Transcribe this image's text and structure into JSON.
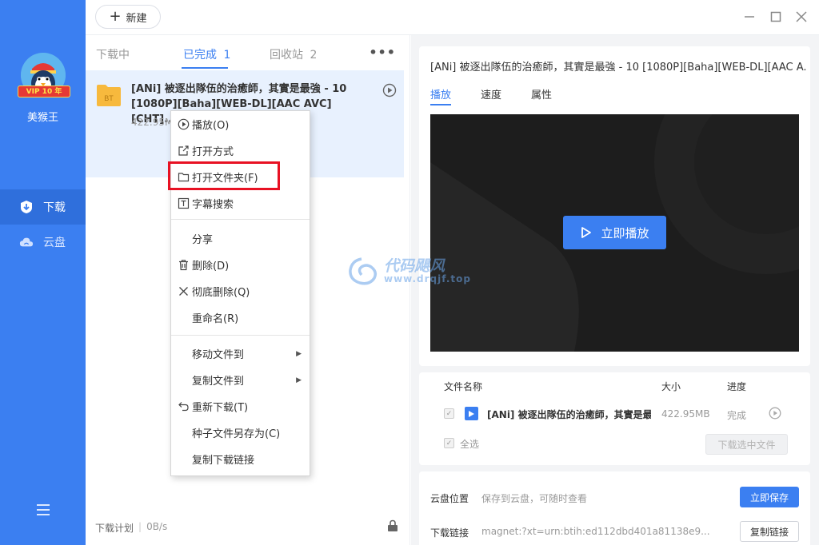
{
  "sidebar": {
    "vip_badge": "VIP 10 年",
    "username": "美猴王",
    "nav": [
      {
        "label": "下载"
      },
      {
        "label": "云盘"
      }
    ]
  },
  "topbar": {
    "new_label": "新建"
  },
  "list": {
    "tabs": [
      {
        "label": "下载中",
        "count": ""
      },
      {
        "label": "已完成",
        "count": "1"
      },
      {
        "label": "回收站",
        "count": "2"
      }
    ],
    "task": {
      "title": "[ANi] 被逐出隊伍的治癒師，其實是最強 - 10 [1080P][Baha][WEB-DL][AAC AVC][CHT]...",
      "size": "422.95M"
    },
    "footer": {
      "plan": "下载计划",
      "speed": "0B/s"
    }
  },
  "context_menu": {
    "items": [
      {
        "label": "播放(O)",
        "icon": "play-circle-icon"
      },
      {
        "label": "打开方式",
        "icon": "open-with-icon"
      },
      {
        "label": "打开文件夹(F)",
        "icon": "folder-icon"
      },
      {
        "label": "字幕搜索",
        "icon": "subtitle-icon"
      },
      {
        "label": "分享",
        "icon": ""
      },
      {
        "label": "删除(D)",
        "icon": "trash-icon"
      },
      {
        "label": "彻底删除(Q)",
        "icon": "close-icon"
      },
      {
        "label": "重命名(R)",
        "icon": ""
      },
      {
        "label": "移动文件到",
        "icon": ""
      },
      {
        "label": "复制文件到",
        "icon": ""
      },
      {
        "label": "重新下载(T)",
        "icon": "redo-icon"
      },
      {
        "label": "种子文件另存为(C)",
        "icon": ""
      },
      {
        "label": "复制下载链接",
        "icon": ""
      }
    ]
  },
  "detail": {
    "title": "[ANi] 被逐出隊伍的治癒師，其實是最強 - 10 [1080P][Baha][WEB-DL][AAC A...",
    "tabs": [
      {
        "label": "播放"
      },
      {
        "label": "速度"
      },
      {
        "label": "属性"
      }
    ],
    "play_now": "立即播放",
    "files": {
      "headers": {
        "name": "文件名称",
        "size": "大小",
        "progress": "进度"
      },
      "row": {
        "name": "[ANi] 被逐出隊伍的治癒師，其實是最強 - 10 [1080P][Baha][WEB-DL][AAC AVC][CHT].mp4",
        "size": "422.95MB",
        "status": "完成"
      },
      "select_all": "全选",
      "download_selected": "下载选中文件"
    },
    "cloud": {
      "label": "云盘位置",
      "text": "保存到云盘，可随时查看",
      "button": "立即保存"
    },
    "link": {
      "label": "下载链接",
      "text": "magnet:?xt=urn:btih:ed112dbd401a81138e9...",
      "button": "复制链接"
    }
  },
  "watermark": {
    "line1": "代码飓风",
    "line2": "www.drqjf.top"
  },
  "colors": {
    "accent": "#3b7ff1",
    "sidebar": "#3b7ff1",
    "highlight": "#e81123"
  }
}
